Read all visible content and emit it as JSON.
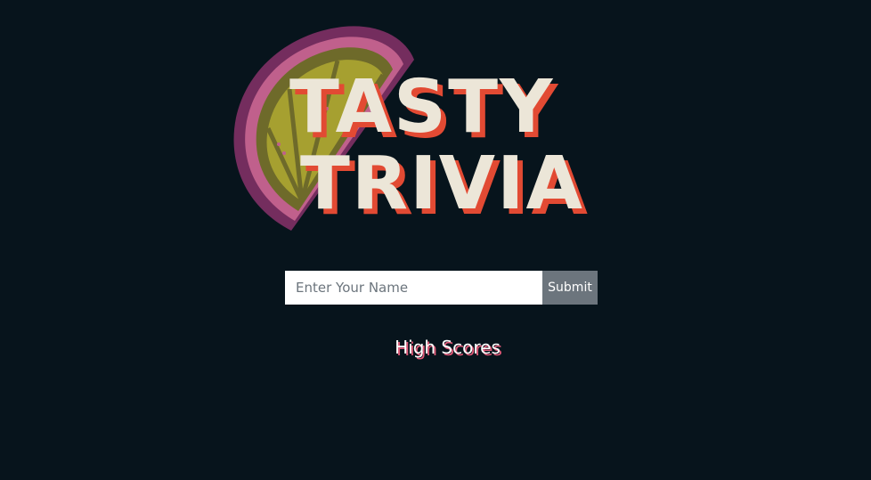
{
  "logo": {
    "line1": "TASTY",
    "line2": "TRIVIA",
    "icon": "lemon-slice-icon"
  },
  "form": {
    "name_placeholder": "Enter Your Name",
    "name_value": "",
    "submit_label": "Submit"
  },
  "links": {
    "high_scores": "High Scores"
  },
  "colors": {
    "background": "#07141c",
    "logo_text": "#ece6d8",
    "logo_shadow": "#e24a33",
    "lemon_rind": "#8b3a6e",
    "lemon_flesh": "#a8a236",
    "button": "#6c757d",
    "high_scores_shadow": "#e05a78"
  }
}
